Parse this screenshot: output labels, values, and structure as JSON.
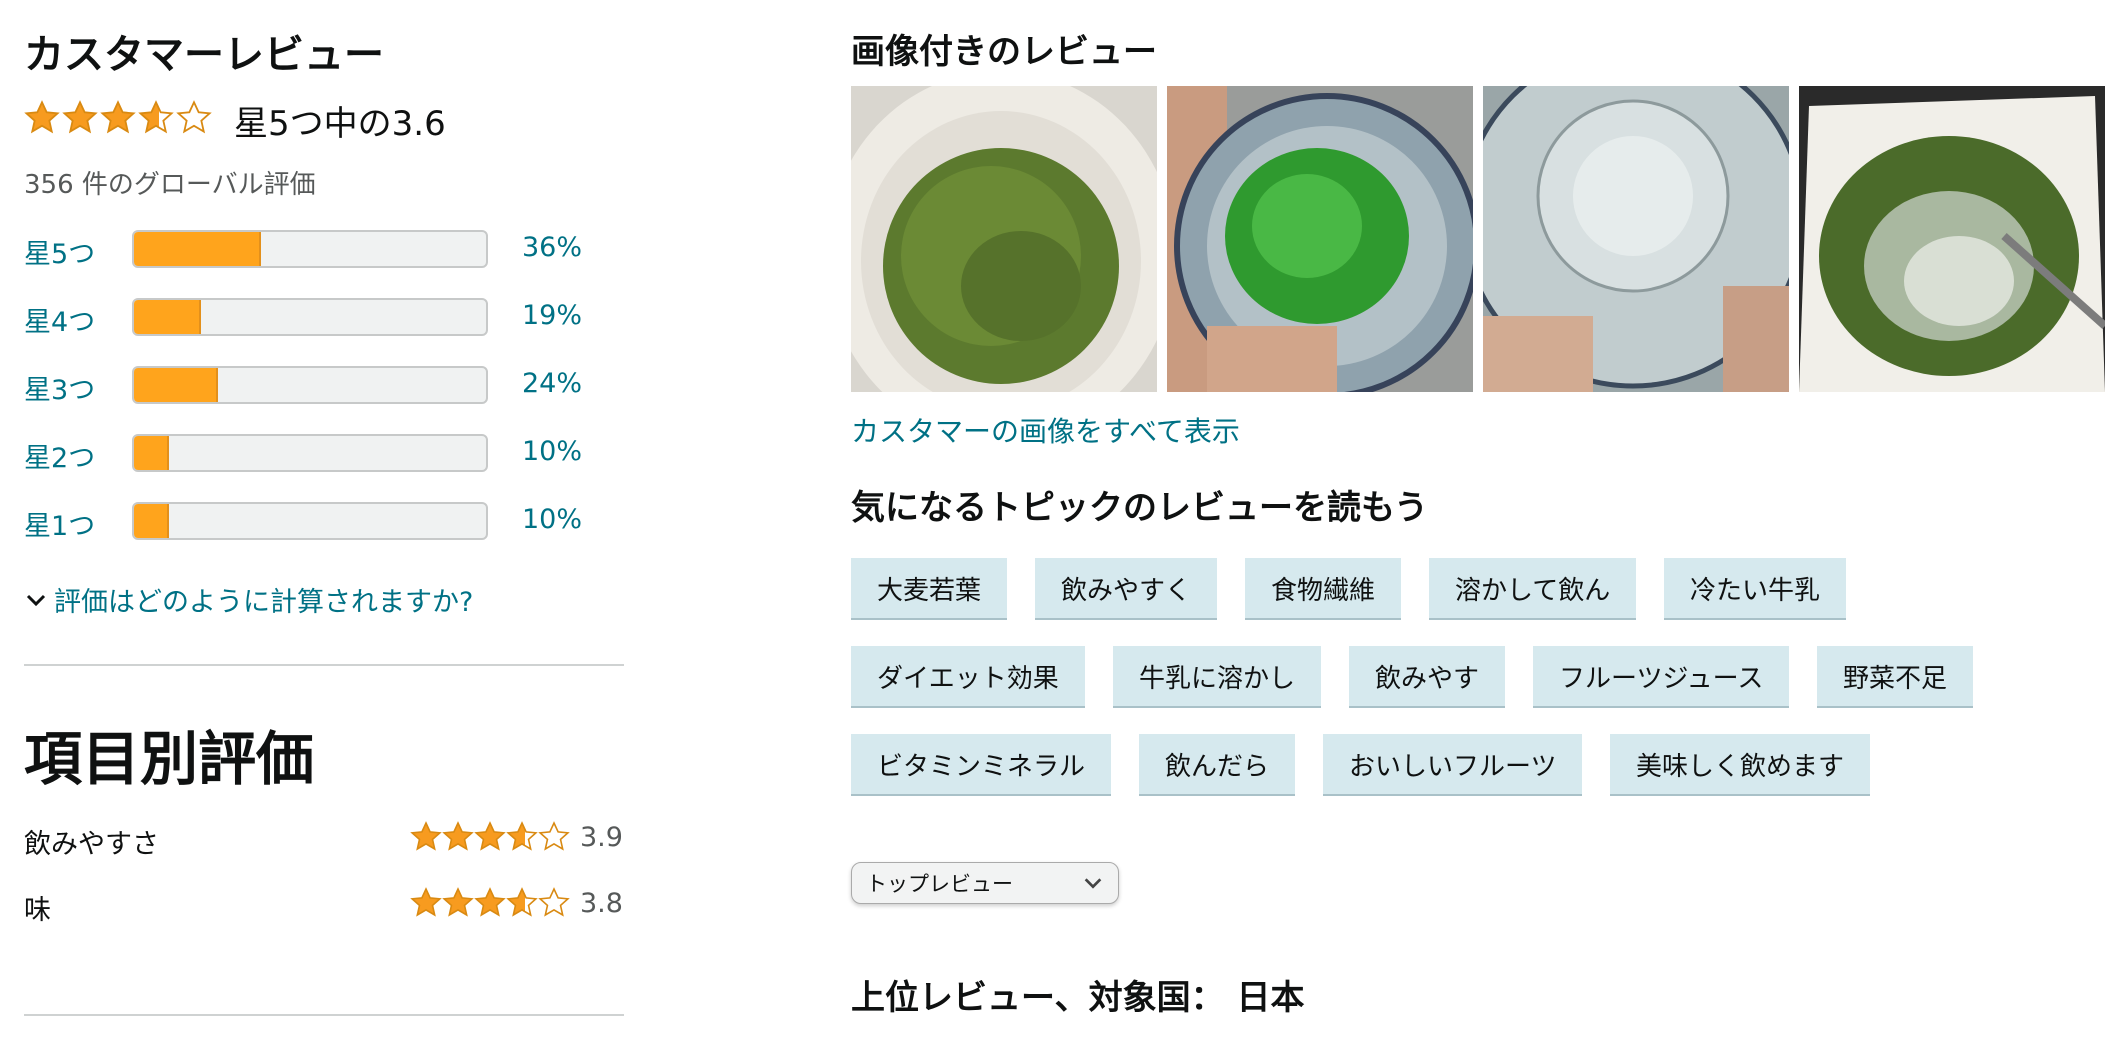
{
  "left": {
    "title": "カスタマーレビュー",
    "overall": {
      "rating": 3.6,
      "text": "星5つ中の3.6"
    },
    "global_count": "356 件のグローバル評価",
    "histogram": [
      {
        "label": "星5つ",
        "percent": 36,
        "percent_text": "36%"
      },
      {
        "label": "星4つ",
        "percent": 19,
        "percent_text": "19%"
      },
      {
        "label": "星3つ",
        "percent": 24,
        "percent_text": "24%"
      },
      {
        "label": "星2つ",
        "percent": 10,
        "percent_text": "10%"
      },
      {
        "label": "星1つ",
        "percent": 10,
        "percent_text": "10%"
      }
    ],
    "how_calculated": "評価はどのように計算されますか?",
    "feature_title": "項目別評価",
    "features": [
      {
        "label": "飲みやすさ",
        "rating": 3.9,
        "value_text": "3.9"
      },
      {
        "label": "味",
        "rating": 3.8,
        "value_text": "3.8"
      }
    ]
  },
  "right": {
    "images_title": "画像付きのレビュー",
    "images": [
      {
        "icon": "green-powder-in-bowl"
      },
      {
        "icon": "green-drink-in-glass"
      },
      {
        "icon": "empty-clear-glass"
      },
      {
        "icon": "powder-cup-with-spoon"
      }
    ],
    "see_all_images": "カスタマーの画像をすべて表示",
    "topics_title": "気になるトピックのレビューを読もう",
    "topics": [
      [
        "大麦若葉",
        "飲みやすく",
        "食物繊維",
        "溶かして飲ん",
        "冷たい牛乳"
      ],
      [
        "ダイエット効果",
        "牛乳に溶かし",
        "飲みやす",
        "フルーツジュース",
        "野菜不足"
      ],
      [
        "ビタミンミネラル",
        "飲んだら",
        "おいしいフルーツ",
        "美味しく飲めます"
      ]
    ],
    "sort": {
      "selected": "トップレビュー"
    },
    "top_reviews_heading": "上位レビュー、対象国： 日本"
  },
  "colors": {
    "star": "#f79b1f",
    "bar_fill": "#ffa41c",
    "link": "#007185",
    "chip_bg": "#d6e9ee"
  }
}
